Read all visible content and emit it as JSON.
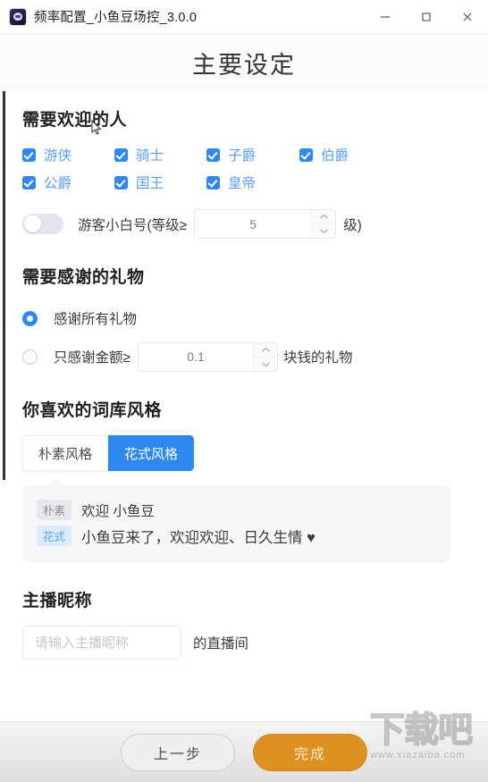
{
  "window": {
    "title": "频率配置_小鱼豆场控_3.0.0",
    "app_icon": "cat-app-icon",
    "controls": {
      "minimize": "minimize-icon",
      "maximize": "maximize-icon",
      "close": "close-icon"
    }
  },
  "page": {
    "title": "主要设定"
  },
  "people": {
    "section_title": "需要欢迎的人",
    "checkboxes": [
      {
        "label": "游侠",
        "checked": true
      },
      {
        "label": "骑士",
        "checked": true
      },
      {
        "label": "子爵",
        "checked": true
      },
      {
        "label": "伯爵",
        "checked": true
      },
      {
        "label": "公爵",
        "checked": true
      },
      {
        "label": "国王",
        "checked": true
      },
      {
        "label": "皇帝",
        "checked": true
      }
    ],
    "guest_toggle": {
      "enabled": false,
      "label_prefix": "游客小白号(等级≥",
      "level_value": "5",
      "label_suffix": "级)"
    }
  },
  "gifts": {
    "section_title": "需要感谢的礼物",
    "options": [
      {
        "label": "感谢所有礼物",
        "selected": true
      },
      {
        "label": "只感谢金额≥",
        "selected": false
      }
    ],
    "amount_value": "0.1",
    "amount_suffix": "块钱的礼物"
  },
  "style": {
    "section_title": "你喜欢的词库风格",
    "tabs": [
      {
        "label": "朴素风格",
        "active": false
      },
      {
        "label": "花式风格",
        "active": true
      }
    ],
    "preview": [
      {
        "tag": "朴素",
        "text": "欢迎 小鱼豆"
      },
      {
        "tag": "花式",
        "text": "小鱼豆来了，欢迎欢迎、日久生情 ♥"
      }
    ]
  },
  "nickname": {
    "section_title": "主播昵称",
    "placeholder": "请输入主播昵称",
    "value": "",
    "suffix": "的直播间"
  },
  "footer": {
    "prev_label": "上一步",
    "done_label": "完成"
  },
  "watermark": {
    "main": "下载吧",
    "sub": "www.xiazaiba.com"
  },
  "colors": {
    "accent_blue": "#2f88ef",
    "label_blue": "#5b9ef0",
    "done_orange": "#dd9122",
    "tag_gray_bg": "#e6e8ec",
    "tag_blue_bg": "#dbeafd"
  }
}
